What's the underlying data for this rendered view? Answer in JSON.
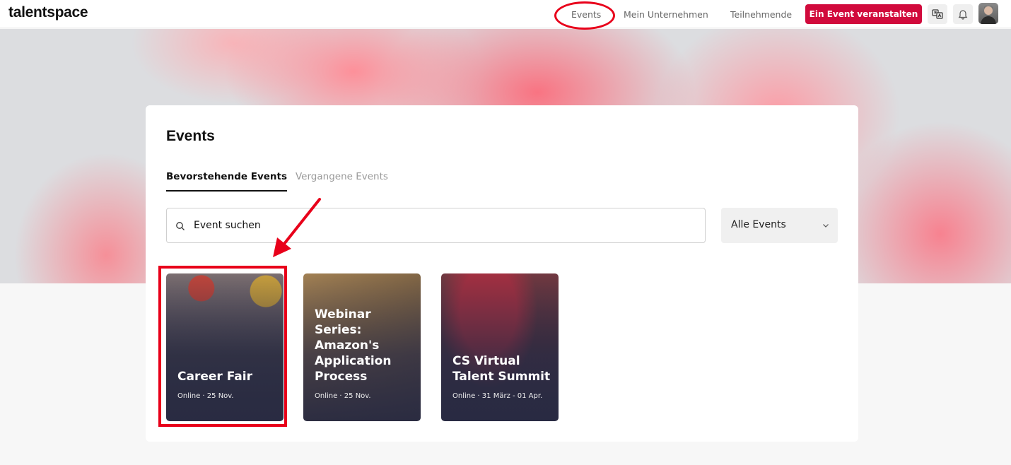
{
  "header": {
    "logo": "talentspace",
    "nav": {
      "events": "Events",
      "company": "Mein Unternehmen",
      "attendees": "Teilnehmende"
    },
    "cta_label": "Ein Event veranstalten",
    "icons": [
      "translate-icon",
      "bell-icon",
      "avatar"
    ]
  },
  "panel": {
    "title": "Events",
    "tabs": {
      "upcoming": "Bevorstehende Events",
      "past": "Vergangene Events"
    },
    "search": {
      "placeholder": "Event suchen"
    },
    "filter": {
      "selected": "Alle Events"
    },
    "events": [
      {
        "title": "Career Fair",
        "meta": "Online · 25 Nov."
      },
      {
        "title": "Webinar Series: Amazon's Application Process",
        "meta": "Online · 25 Nov."
      },
      {
        "title": "CS Virtual Talent Summit",
        "meta": "Online · 31 März - 01 Apr."
      }
    ]
  },
  "colors": {
    "brand": "#d10a3c",
    "annotation": "#e8001a"
  }
}
